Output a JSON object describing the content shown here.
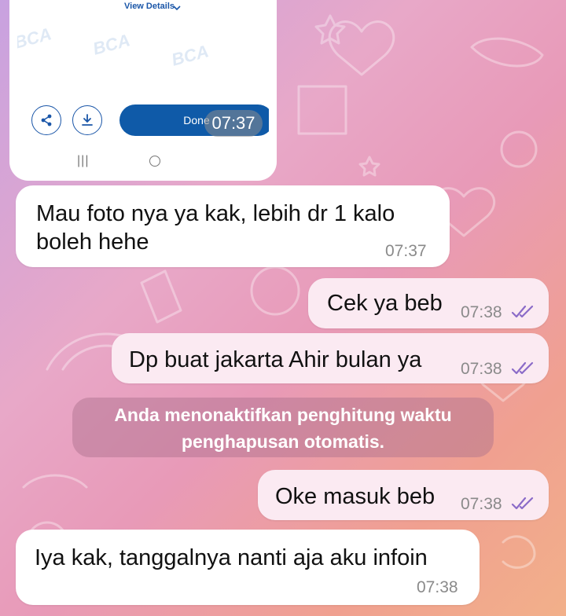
{
  "image_message": {
    "view_details": "View Details",
    "watermark": "BCA",
    "done_label": "Done",
    "time": "07:37"
  },
  "messages": [
    {
      "text": "Mau foto nya ya kak, lebih dr 1 kalo boleh hehe",
      "time": "07:37",
      "direction": "in"
    },
    {
      "text": "Cek ya beb",
      "time": "07:38",
      "direction": "out"
    },
    {
      "text": "Dp buat jakarta Ahir bulan ya",
      "time": "07:38",
      "direction": "out"
    },
    {
      "text": "Oke masuk beb",
      "time": "07:38",
      "direction": "out"
    },
    {
      "text": "Iya kak, tanggalnya nanti aja aku infoin",
      "time": "07:38",
      "direction": "in"
    }
  ],
  "system_note": "Anda menonaktifkan penghitung waktu penghapusan otomatis.",
  "colors": {
    "incoming_bubble": "#ffffff",
    "outgoing_bubble": "#fbeaf2",
    "read_ticks": "#8b6bc8",
    "bank_blue": "#0f5aa8"
  }
}
